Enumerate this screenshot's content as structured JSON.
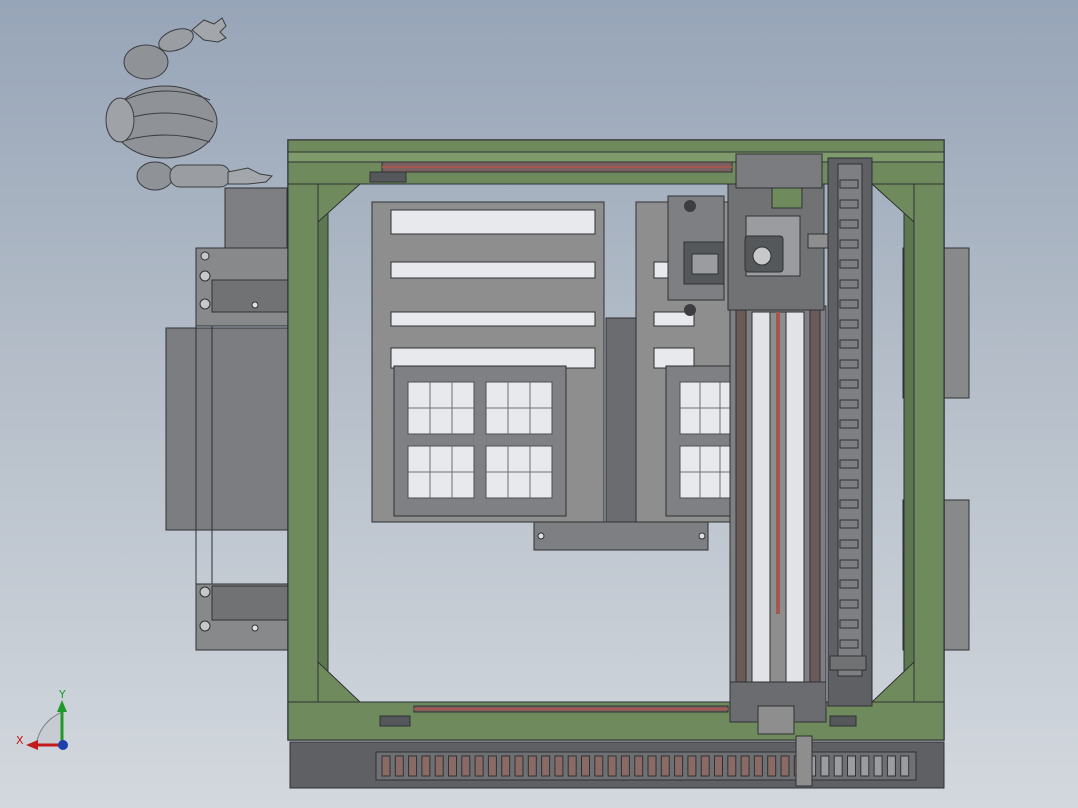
{
  "view": {
    "background_top": "#97a5b8",
    "background_bottom": "#d3d8de"
  },
  "colors": {
    "frame_green": "#6f8a5c",
    "frame_green_dark": "#4f6a44",
    "steel": "#7d7f82",
    "steel_dark": "#55585b",
    "panel": "#8e8e8e",
    "rail_red": "#a2574f",
    "robot_grey": "#8f9398",
    "axis_x": "#c21a1a",
    "axis_y": "#1f9a2a",
    "axis_z": "#1c3fae"
  },
  "triad": {
    "x_label": "X",
    "y_label": "Y",
    "x_icon": "axis-x-arrow-icon",
    "y_icon": "axis-y-arrow-icon",
    "z_icon": "axis-z-dot-icon"
  }
}
